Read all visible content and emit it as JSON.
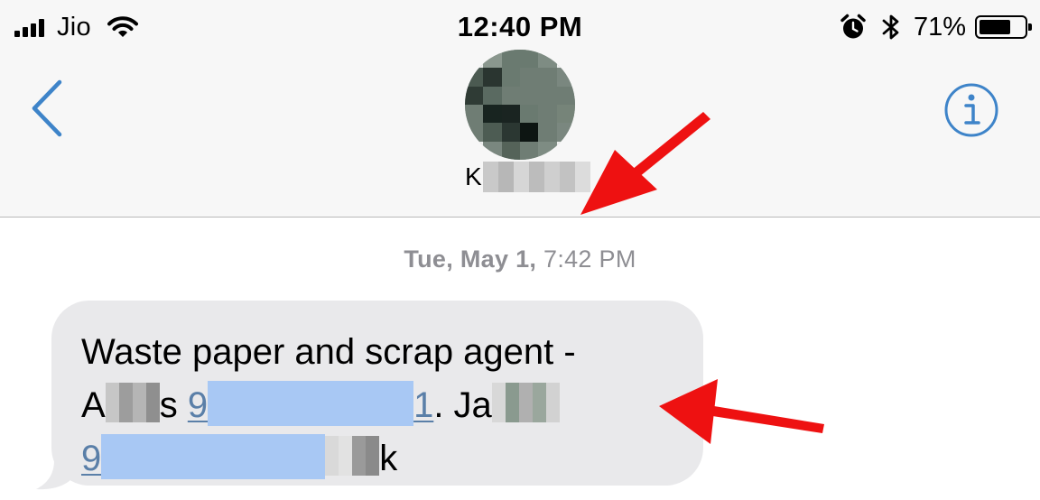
{
  "status_bar": {
    "carrier": "Jio",
    "time": "12:40 PM",
    "battery_percent": "71%",
    "battery_level": 0.71,
    "icons": [
      "signal-icon",
      "wifi-icon",
      "alarm-icon",
      "bluetooth-icon",
      "battery-icon"
    ]
  },
  "nav": {
    "back_icon": "chevron-left-icon",
    "info_icon": "info-icon",
    "contact_initial": "K"
  },
  "conversation": {
    "timestamp_date": "Tue, May 1,",
    "timestamp_time": "7:42 PM",
    "message": {
      "line1": "Waste paper and scrap agent -",
      "line2_start": "A",
      "line2_mid": "s ",
      "phone1_start": "9",
      "phone1_end": "1",
      "line2_after": ". Ja",
      "phone2_start": "9",
      "line3_end": "k"
    }
  },
  "colors": {
    "accent": "#2f7de1",
    "bubble": "#e9e9eb",
    "annotation": "#ee1111",
    "redaction_blue": "#a8c8f4"
  }
}
